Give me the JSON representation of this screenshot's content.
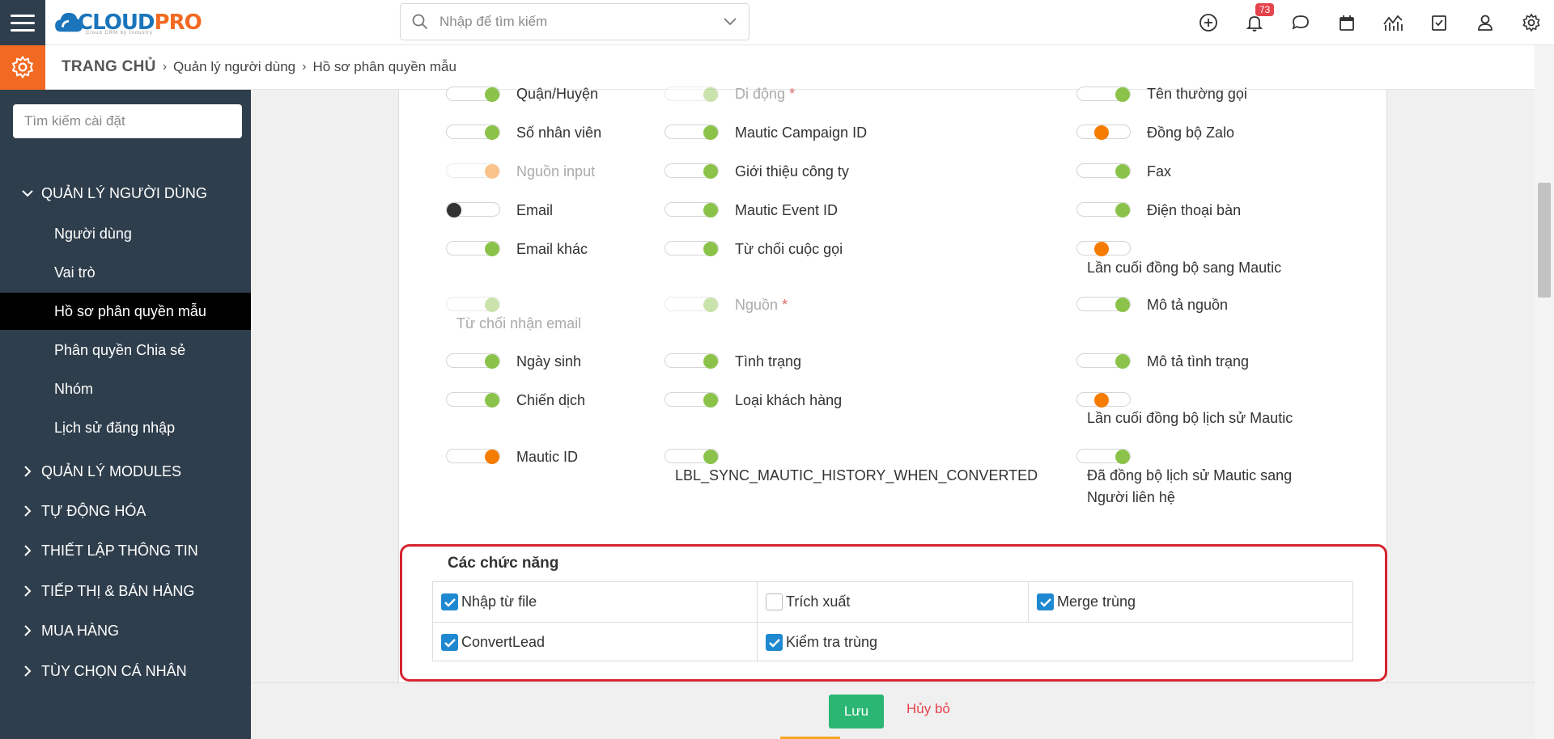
{
  "topbar": {
    "logo_primary": "CLOUD",
    "logo_secondary": "PRO",
    "logo_sub": "Cloud CRM by Industry",
    "search_placeholder": "Nhập để tìm kiếm",
    "notification_count": "73",
    "icons": [
      "plus-circle-icon",
      "bell-icon",
      "chat-icon",
      "calendar-icon",
      "chart-icon",
      "checkbox-icon",
      "user-icon",
      "gear-icon"
    ]
  },
  "breadcrumb": {
    "home": "TRANG CHỦ",
    "level1": "Quản lý người dùng",
    "level2": "Hồ sơ phân quyền mẫu"
  },
  "sidebar": {
    "search_placeholder": "Tìm kiếm cài đặt",
    "section_open": "QUẢN LÝ NGƯỜI DÙNG",
    "items": [
      "Người dùng",
      "Vai trò",
      "Hồ sơ phân quyền mẫu",
      "Phân quyền Chia sẻ",
      "Nhóm",
      "Lịch sử đăng nhập"
    ],
    "sections": [
      "QUẢN LÝ MODULES",
      "TỰ ĐỘNG HÓA",
      "THIẾT LẬP THÔNG TIN",
      "TIẾP THỊ & BÁN HÀNG",
      "MUA HÀNG",
      "TÙY CHỌN CÁ NHÂN"
    ]
  },
  "fields": {
    "c1": [
      "Quận/Huyện",
      "Số nhân viên",
      "Nguồn input",
      "Email",
      "Email khác",
      "Từ chối nhận email",
      "Ngày sinh",
      "Chiến dịch",
      "Mautic ID"
    ],
    "c2": [
      "Di động",
      "Mautic Campaign ID",
      "Giới thiệu công ty",
      "Mautic Event ID",
      "Từ chối cuộc gọi",
      "Nguồn",
      "Tình trạng",
      "Loại khách hàng",
      "LBL_SYNC_MAUTIC_HISTORY_WHEN_CONVERTED"
    ],
    "c3": [
      "Tên thường gọi",
      "Đồng bộ Zalo",
      "Fax",
      "Điện thoại bàn",
      "Lần cuối đồng bộ sang Mautic",
      "Mô tả nguồn",
      "Mô tả tình trạng",
      "Lần cuối đồng bộ lịch sử Mautic",
      "Đã đồng bộ lịch sử Mautic sang",
      "Người liên hệ"
    ],
    "required_mark": "*"
  },
  "functions": {
    "title": "Các chức năng",
    "import": "Nhập từ file",
    "export": "Trích xuất",
    "merge": "Merge trùng",
    "convert": "ConvertLead",
    "check_duplicate": "Kiểm tra trùng"
  },
  "footer": {
    "save": "Lưu",
    "cancel": "Hủy bỏ"
  },
  "colors": {
    "sidebar_bg": "#2f3e4c",
    "accent_orange": "#f26a22",
    "toggle_green": "#8bc34a",
    "save_green": "#2bb673",
    "checkbox_blue": "#1e88d0",
    "highlight_red": "#d6242f"
  }
}
